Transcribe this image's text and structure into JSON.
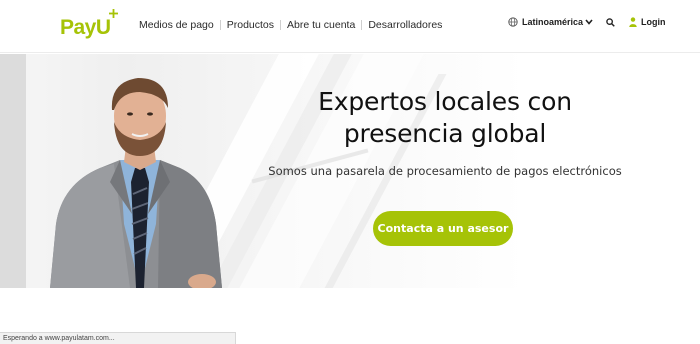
{
  "brand": {
    "name": "PayU",
    "accent_color": "#a6c307"
  },
  "nav": {
    "items": [
      {
        "label": "Medios de pago"
      },
      {
        "label": "Productos"
      },
      {
        "label": "Abre tu cuenta"
      },
      {
        "label": "Desarrolladores"
      }
    ]
  },
  "header_right": {
    "region": {
      "label": "Latinoamérica",
      "icon": "globe-icon",
      "dropdown_icon": "chevron-down-icon"
    },
    "search_icon": "search-icon",
    "login": {
      "label": "Login",
      "icon": "user-icon"
    }
  },
  "hero": {
    "headline_line1": "Expertos locales con",
    "headline_line2": "presencia global",
    "subtitle": "Somos una pasarela de procesamiento de pagos electrónicos",
    "cta_label": "Contacta a un asesor"
  },
  "status_bar": {
    "text": "Esperando a www.payulatam.com..."
  }
}
